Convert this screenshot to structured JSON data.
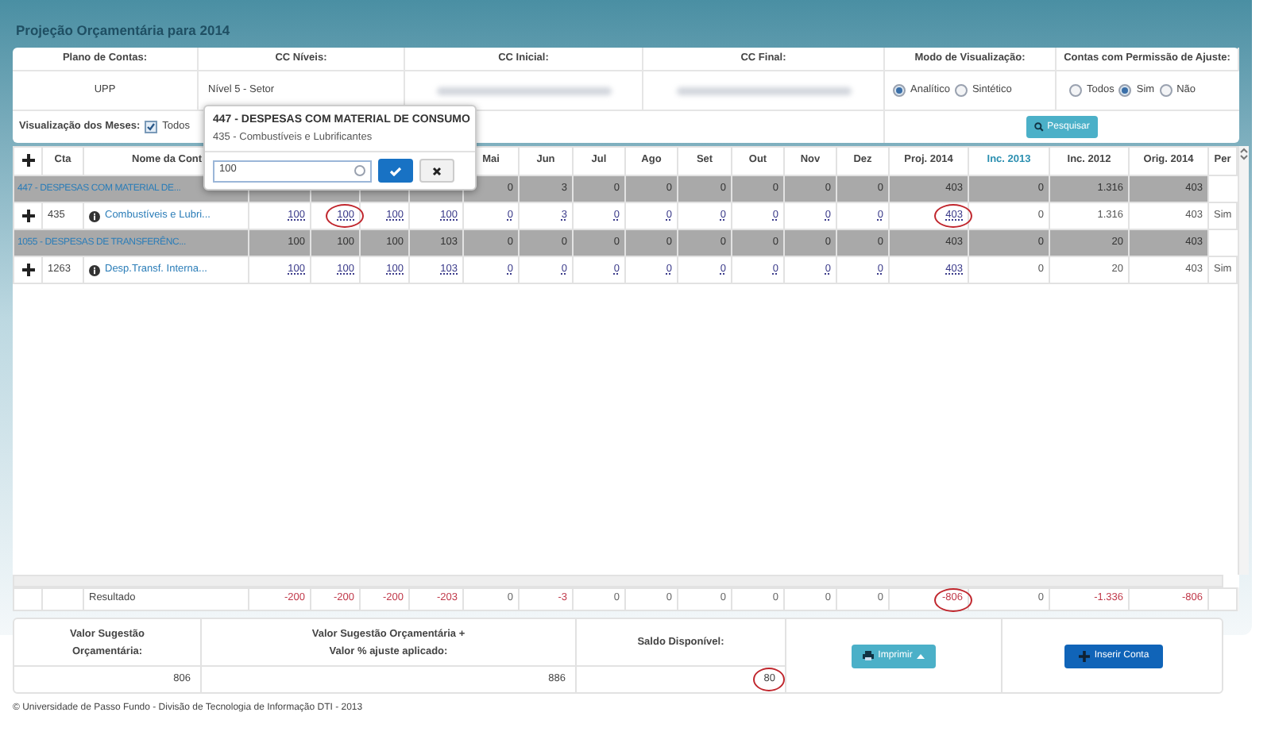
{
  "title": "Projeção Orçamentária para 2014",
  "filters": {
    "headers": [
      "Plano de Contas:",
      "CC Níveis:",
      "CC Inicial:",
      "CC Final:",
      "Modo de Visualização:",
      "Contas com Permissão de Ajuste:"
    ],
    "plano": "UPP",
    "niveis": "Nível 5 - Setor",
    "modo_options": [
      {
        "label": "Analítico",
        "selected": true
      },
      {
        "label": "Sintético",
        "selected": false
      }
    ],
    "permissao_options": [
      {
        "label": "Todos",
        "selected": false
      },
      {
        "label": "Sim",
        "selected": true
      },
      {
        "label": "Não",
        "selected": false
      }
    ],
    "months_label": "Visualização dos Meses:",
    "months_all": {
      "label": "Todos",
      "checked": true
    },
    "search_button": "Pesquisar"
  },
  "popover": {
    "title": "447 - DESPESAS COM MATERIAL DE CONSUMO",
    "subtitle": "435 - Combustíveis e Lubrificantes",
    "input_value": "100"
  },
  "table": {
    "columns_left": [
      "Cta",
      "Nome da Cont"
    ],
    "columns": [
      {},
      {},
      {},
      {},
      {
        "label": "Mai",
        "highlight": false
      },
      {
        "label": "Jun",
        "highlight": false
      },
      {
        "label": "Jul",
        "highlight": false
      },
      {
        "label": "Ago",
        "highlight": false
      },
      {
        "label": "Set",
        "highlight": false
      },
      {
        "label": "Out",
        "highlight": false
      },
      {
        "label": "Nov",
        "highlight": false
      },
      {
        "label": "Dez",
        "highlight": false
      },
      {
        "label": "Proj. 2014",
        "highlight": false
      },
      {
        "label": "Inc. 2013",
        "highlight": true
      },
      {
        "label": "Inc. 2012",
        "highlight": false
      },
      {
        "label": "Orig. 2014",
        "highlight": false
      },
      {
        "label": "Per",
        "highlight": false
      }
    ],
    "rows": [
      {
        "kind": "group",
        "label": "447 - DESPESAS COM MATERIAL DE...",
        "cells": [
          {},
          {},
          {},
          {},
          {
            "t": "0",
            "circled": false
          },
          {
            "t": "3",
            "circled": false
          },
          {
            "t": "0",
            "circled": false
          },
          {
            "t": "0",
            "circled": false
          },
          {
            "t": "0",
            "circled": false
          },
          {
            "t": "0",
            "circled": false
          },
          {
            "t": "0",
            "circled": false
          },
          {
            "t": "0",
            "circled": false
          },
          {
            "t": "403",
            "circled": false
          },
          {
            "t": "0",
            "circled": false
          },
          {
            "t": "1.316",
            "circled": false
          },
          {
            "t": "403",
            "circled": false
          }
        ]
      },
      {
        "kind": "detail",
        "cta": "435",
        "name": "Combustíveis e Lubri...",
        "cells": [
          {
            "t": "100",
            "circled": false
          },
          {
            "t": "100",
            "circled": true
          },
          {
            "t": "100",
            "circled": false
          },
          {
            "t": "100",
            "circled": false
          },
          {
            "t": "0",
            "circled": false
          },
          {
            "t": "3",
            "circled": false
          },
          {
            "t": "0",
            "circled": false
          },
          {
            "t": "0",
            "circled": false
          },
          {
            "t": "0",
            "circled": false
          },
          {
            "t": "0",
            "circled": false
          },
          {
            "t": "0",
            "circled": false
          },
          {
            "t": "0",
            "circled": false
          },
          {
            "t": "403",
            "circled": true
          },
          {
            "t": "0",
            "circled": false
          },
          {
            "t": "1.316",
            "circled": false
          },
          {
            "t": "403",
            "circled": false
          },
          {
            "t": "Sim",
            "circled": false
          }
        ]
      },
      {
        "kind": "group",
        "label": "1055 - DESPESAS DE TRANSFERÊNC...",
        "cells": [
          {
            "t": "100",
            "circled": false
          },
          {
            "t": "100",
            "circled": false
          },
          {
            "t": "100",
            "circled": false
          },
          {
            "t": "103",
            "circled": false
          },
          {
            "t": "0",
            "circled": false
          },
          {
            "t": "0",
            "circled": false
          },
          {
            "t": "0",
            "circled": false
          },
          {
            "t": "0",
            "circled": false
          },
          {
            "t": "0",
            "circled": false
          },
          {
            "t": "0",
            "circled": false
          },
          {
            "t": "0",
            "circled": false
          },
          {
            "t": "0",
            "circled": false
          },
          {
            "t": "403",
            "circled": false
          },
          {
            "t": "0",
            "circled": false
          },
          {
            "t": "20",
            "circled": false
          },
          {
            "t": "403",
            "circled": false
          }
        ]
      },
      {
        "kind": "detail",
        "cta": "1263",
        "name": "Desp.Transf. Interna...",
        "cells": [
          {
            "t": "100",
            "circled": false
          },
          {
            "t": "100",
            "circled": false
          },
          {
            "t": "100",
            "circled": false
          },
          {
            "t": "103",
            "circled": false
          },
          {
            "t": "0",
            "circled": false
          },
          {
            "t": "0",
            "circled": false
          },
          {
            "t": "0",
            "circled": false
          },
          {
            "t": "0",
            "circled": false
          },
          {
            "t": "0",
            "circled": false
          },
          {
            "t": "0",
            "circled": false
          },
          {
            "t": "0",
            "circled": false
          },
          {
            "t": "0",
            "circled": false
          },
          {
            "t": "403",
            "circled": false
          },
          {
            "t": "0",
            "circled": false
          },
          {
            "t": "20",
            "circled": false
          },
          {
            "t": "403",
            "circled": false
          },
          {
            "t": "Sim",
            "circled": false
          }
        ]
      }
    ],
    "result": {
      "label": "Resultado",
      "cells": [
        {
          "t": "-200",
          "negative": true,
          "circled": false
        },
        {
          "t": "-200",
          "negative": true,
          "circled": false
        },
        {
          "t": "-200",
          "negative": true,
          "circled": false
        },
        {
          "t": "-203",
          "negative": true,
          "circled": false
        },
        {
          "t": "0",
          "negative": false,
          "circled": false
        },
        {
          "t": "-3",
          "negative": true,
          "circled": false
        },
        {
          "t": "0",
          "negative": false,
          "circled": false
        },
        {
          "t": "0",
          "negative": false,
          "circled": false
        },
        {
          "t": "0",
          "negative": false,
          "circled": false
        },
        {
          "t": "0",
          "negative": false,
          "circled": false
        },
        {
          "t": "0",
          "negative": false,
          "circled": false
        },
        {
          "t": "0",
          "negative": false,
          "circled": false
        },
        {
          "t": "-806",
          "negative": true,
          "circled": true
        },
        {
          "t": "0",
          "negative": false,
          "circled": false
        },
        {
          "t": "-1.336",
          "negative": true,
          "circled": false
        },
        {
          "t": "-806",
          "negative": true,
          "circled": false
        }
      ]
    }
  },
  "summary": {
    "items": [
      {
        "label_lines": [
          "Valor Sugestão",
          "Orçamentária:"
        ],
        "value": "806",
        "circled": false
      },
      {
        "label_lines": [
          "Valor Sugestão Orçamentária +",
          "Valor % ajuste aplicado:"
        ],
        "value": "886",
        "circled": false
      },
      {
        "label_lines": [
          "Saldo Disponível:"
        ],
        "value": "80",
        "circled": true
      }
    ],
    "print_button": "Imprimir",
    "insert_button": "Inserir Conta"
  },
  "footer": "© Universidade de Passo Fundo - Divisão de Tecnologia de Informação DTI - 2013"
}
